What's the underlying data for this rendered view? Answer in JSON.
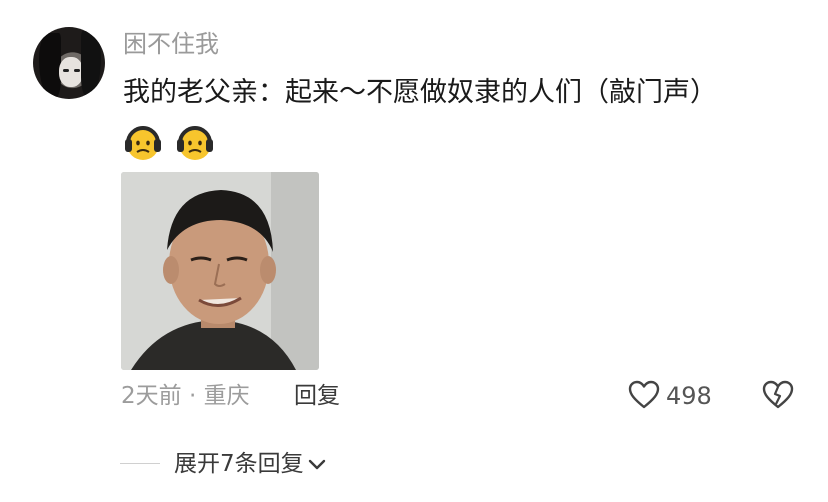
{
  "comment": {
    "username": "困不住我",
    "text": "我的老父亲：起来～不愿做奴隶的人们（敲门声）",
    "emojis": [
      "headphone-face-emoji",
      "headphone-face-emoji"
    ],
    "meta": "2天前 · 重庆",
    "reply_label": "回复",
    "like_count": "498",
    "icons": {
      "like": "heart-outline-icon",
      "dislike": "broken-heart-icon",
      "expand": "chevron-down-icon"
    }
  },
  "replies": {
    "expand_label": "展开7条回复"
  },
  "colors": {
    "muted": "#9a9a9a",
    "text": "#1a1a1a",
    "emoji": "#f7c52d"
  }
}
